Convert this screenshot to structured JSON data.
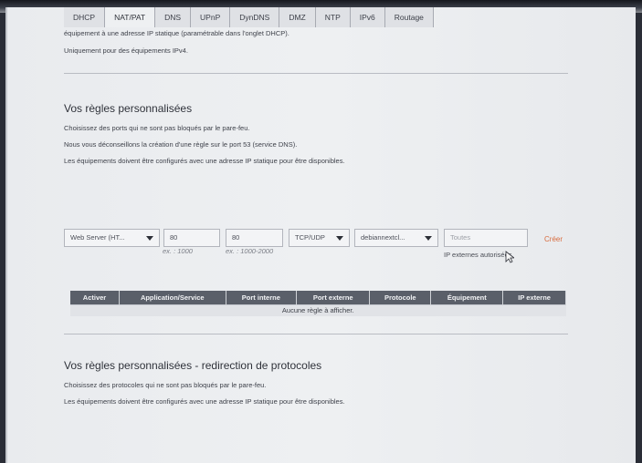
{
  "tabs": [
    "DHCP",
    "NAT/PAT",
    "DNS",
    "UPnP",
    "DynDNS",
    "DMZ",
    "NTP",
    "IPv6",
    "Routage"
  ],
  "top_notes": [
    "équipement à une adresse IP statique (paramétrable dans l'onglet DHCP).",
    "Uniquement pour des équipements IPv4."
  ],
  "section1": {
    "title": "Vos règles personnalisées",
    "lines": [
      "Choisissez des ports qui ne sont pas bloqués par le pare-feu.",
      "Nous vous déconseillons la création d'une règle sur le port 53 (service DNS).",
      "Les équipements doivent être configurés avec une adresse IP statique pour être disponibles."
    ]
  },
  "form": {
    "application": "Web Server (HT...",
    "internal_port": "80",
    "internal_hint": "ex. : 1000",
    "external_port": "80",
    "external_hint": "ex. : 1000-2000",
    "protocol": "TCP/UDP",
    "device": "debiannextcl...",
    "external_ip_placeholder": "Toutes",
    "external_ip_note": "IP externes autorisées",
    "create_label": "Créer"
  },
  "table": {
    "headers": [
      "Activer",
      "Application/Service",
      "Port interne",
      "Port externe",
      "Protocole",
      "Équipement",
      "IP externe"
    ],
    "empty_message": "Aucune règle à afficher."
  },
  "section2": {
    "title": "Vos règles personnalisées - redirection de protocoles",
    "lines": [
      "Choisissez des protocoles qui ne sont pas bloqués par le pare-feu.",
      "Les équipements doivent être configurés avec une adresse IP statique pour être disponibles."
    ]
  },
  "icons": {
    "dropdown": "chevron-down-icon",
    "cursor": "mouse-cursor-icon"
  }
}
